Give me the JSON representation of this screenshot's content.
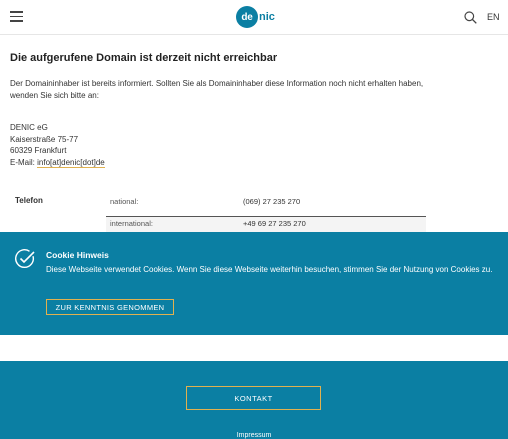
{
  "header": {
    "logo_mark": "de",
    "logo_text": "nic",
    "lang": "EN",
    "icons": {
      "menu": "hamburger-menu-icon",
      "search": "search-icon"
    }
  },
  "main": {
    "title": "Die aufgerufene Domain ist derzeit nicht erreichbar",
    "intro": "Der Domaininhaber ist bereits informiert. Sollten Sie als Domaininhaber diese Information noch nicht erhalten haben, wenden Sie sich bitte an:",
    "address": {
      "company": "DENIC eG",
      "street": "Kaiserstraße 75-77",
      "city": "60329 Frankfurt",
      "email_label": "E-Mail: ",
      "email": "info[at]denic[dot]de"
    },
    "phone": {
      "label": "Telefon",
      "rows": [
        {
          "key": "national:",
          "value": "(069) 27 235 270"
        },
        {
          "key": "international:",
          "value": "+49 69 27 235 270"
        }
      ]
    }
  },
  "cookie": {
    "title": "Cookie Hinweis",
    "text": "Diese Webseite verwendet Cookies. Wenn Sie diese Webseite weiterhin besuchen, stimmen Sie der Nutzung von Cookies zu.",
    "button": "ZUR KENNTNIS GENOMMEN"
  },
  "footer": {
    "contact_button": "KONTAKT",
    "impressum": "Impressum"
  },
  "colors": {
    "brand": "#0b7fa3",
    "accent_border": "#e0b14f"
  }
}
